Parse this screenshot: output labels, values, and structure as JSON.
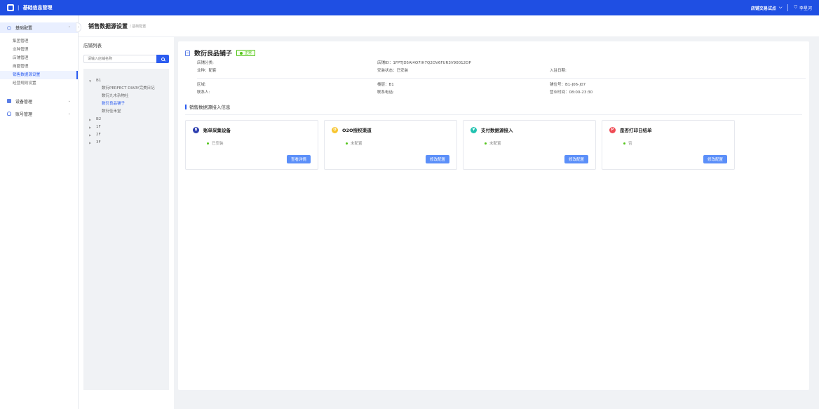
{
  "topbar": {
    "title": "基础信息管理",
    "store_selector": "店铺交易试点",
    "user": "李星河"
  },
  "sidebar": {
    "groups": [
      {
        "label": "基础配置",
        "expanded": true,
        "items": [
          "集团管理",
          "业种管理",
          "店铺管理",
          "商圈管理",
          "销售数据源设置",
          "经营规则设置"
        ],
        "active_item": "销售数据源设置"
      },
      {
        "label": "设备管理",
        "expanded": false
      },
      {
        "label": "账号管理",
        "expanded": false
      }
    ]
  },
  "page": {
    "title": "销售数据源设置",
    "breadcrumb": "/ 基础配置"
  },
  "store_list": {
    "title": "店铺列表",
    "search_placeholder": "请输入店铺名称",
    "tree": [
      {
        "label": "B1",
        "expanded": true,
        "children": [
          "数衍PERFECT DIARY完美日记",
          "数衍九木杂物社",
          "数衍良品铺子",
          "数衍佳禾堂"
        ],
        "active_child": "数衍良品铺子"
      },
      {
        "label": "B2",
        "expanded": false
      },
      {
        "label": "1F",
        "expanded": false
      },
      {
        "label": "2F",
        "expanded": false
      },
      {
        "label": "3F",
        "expanded": false
      }
    ]
  },
  "store": {
    "name": "数衍良品铺子",
    "status": "正常",
    "category": "店铺分类:",
    "store_id": "店铺ID：1FPTJD5AI4O7IH7Q2OV6FUR3V90012OP",
    "business_type": "业种：配套",
    "install_status": "安装状态：已安装",
    "entry_date": "入驻日期:",
    "area": "区域:",
    "floor": "楼层：B1",
    "shop_no": "铺位号：B1-J06-J07",
    "contact": "联系人:",
    "phone": "联系电话:",
    "hours": "营业时间：08:00-23:30"
  },
  "section": {
    "title": "销售数据源接入信息"
  },
  "cards": [
    {
      "title": "账单采集设备",
      "icon": "invoice-device-icon",
      "color": "#2e3fb0",
      "status": "已安装",
      "button": "查看详情"
    },
    {
      "title": "O2O授权渠道",
      "icon": "o2o-channel-icon",
      "color": "#f7c530",
      "status": "未配置",
      "button": "修改配置"
    },
    {
      "title": "支付数据源接入",
      "icon": "payment-source-icon",
      "color": "#22c2b0",
      "status": "未配置",
      "button": "修改配置"
    },
    {
      "title": "是否打印日结单",
      "icon": "print-receipt-icon",
      "color": "#ef4b55",
      "status": "否",
      "button": "修改配置"
    }
  ]
}
